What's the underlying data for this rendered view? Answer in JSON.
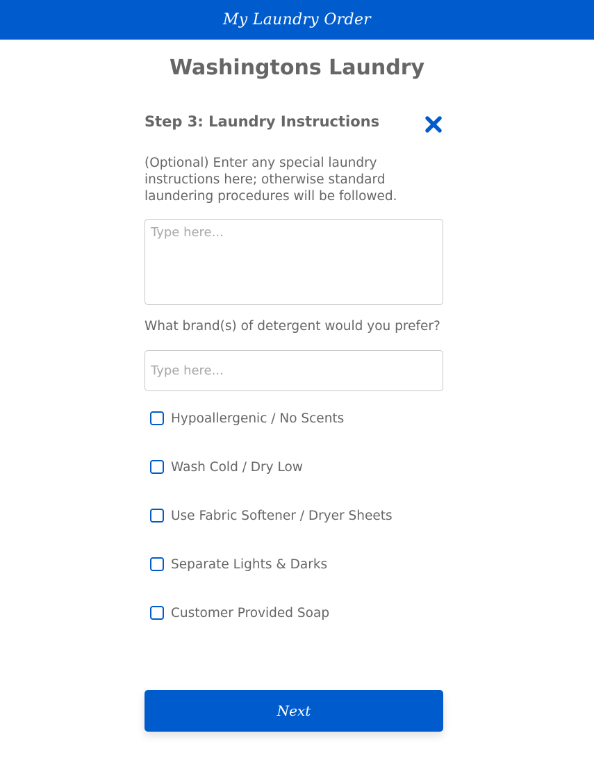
{
  "header": {
    "title": "My Laundry Order"
  },
  "business_name": "Washingtons Laundry",
  "step": {
    "title": "Step 3: Laundry Instructions",
    "close_icon": "close-x-icon",
    "instructions_text": "(Optional) Enter any special laundry instructions here; otherwise standard laundering procedures will be followed.",
    "instructions_field": {
      "value": "",
      "placeholder": "Type here..."
    },
    "detergent_question": "What brand(s) of detergent would you prefer?",
    "detergent_field": {
      "value": "",
      "placeholder": "Type here..."
    },
    "options": [
      {
        "label": "Hypoallergenic / No Scents",
        "checked": false
      },
      {
        "label": "Wash Cold / Dry Low",
        "checked": false
      },
      {
        "label": "Use Fabric Softener / Dryer Sheets",
        "checked": false
      },
      {
        "label": "Separate Lights & Darks",
        "checked": false
      },
      {
        "label": "Customer Provided Soap",
        "checked": false
      }
    ],
    "next_label": "Next"
  },
  "colors": {
    "accent": "#005ccc",
    "text": "#666666",
    "border": "#c8c8c8",
    "placeholder": "#a8a8a8",
    "background": "#ffffff"
  }
}
